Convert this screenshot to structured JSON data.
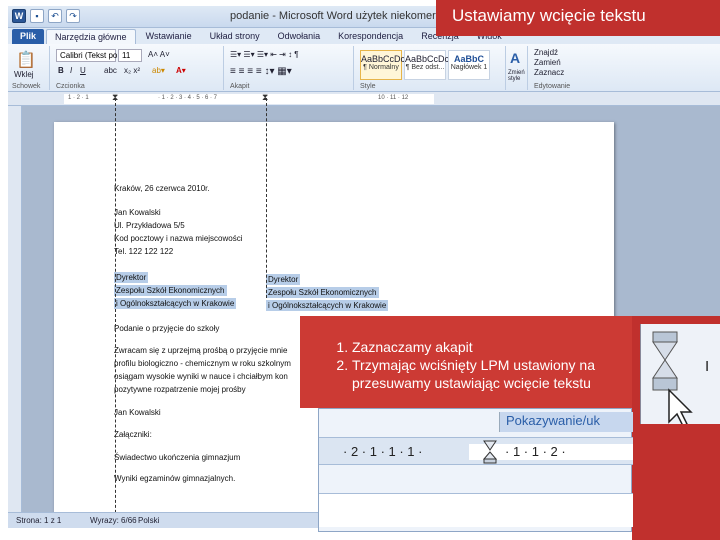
{
  "window": {
    "title": "podanie - Microsoft Word użytek niekomercyjny"
  },
  "tabs": [
    "Plik",
    "Narzędzia główne",
    "Wstawianie",
    "Układ strony",
    "Odwołania",
    "Korespondencja",
    "Recenzja",
    "Widok"
  ],
  "ribbon": {
    "font_name": "Calibri (Tekst po",
    "font_size": "11",
    "paste_label": "Wklej",
    "styles": [
      {
        "sample": "AaBbCcDc",
        "name": "¶ Normalny"
      },
      {
        "sample": "AaBbCcDc",
        "name": "¶ Bez odst..."
      },
      {
        "sample": "AaBbC",
        "name": "Nagłówek 1"
      }
    ],
    "change_styles": "Zmień style",
    "find": "Znajdź",
    "replace": "Zamień",
    "select": "Zaznacz",
    "group_labels": [
      "Schowek",
      "Czcionka",
      "Akapit",
      "Style",
      "Edytowanie"
    ]
  },
  "ruler": {
    "ticks": [
      "1 · 2 · 1",
      "· 1 · 2 · 3 · 4 · 5 · 6 · 7",
      "10 · 11 · 12"
    ]
  },
  "document": {
    "lines": [
      "Kraków, 26 czerwca 2010r.",
      "Jan Kowalski",
      "Ul. Przykładowa 5/5",
      "Kod pocztowy i nazwa miejscowości",
      "Tel. 122 122 122",
      "Dyrektor",
      "Zespołu Szkół Ekonomicznych",
      "i Ogólnokształcących w Krakowie",
      "Podanie o przyjęcie do szkoły",
      "Zwracam się z uprzejmą prośbą o przyjęcie mnie",
      "profilu biologiczno - chemicznym w roku szkolnym",
      "osiągam wysokie wyniki w nauce i chciałbym kon",
      "pozytywne rozpatrzenie mojej prośby",
      "Jan Kowalski",
      "Załączniki:",
      "Świadectwo ukończenia gimnazjum",
      "Wyniki egzaminów gimnazjalnych."
    ],
    "indented_copy": [
      "Dyrektor",
      "Zespołu Szkół Ekonomicznych",
      "i Ogólnokształcących w Krakowie"
    ]
  },
  "statusbar": {
    "page": "Strona: 1 z 1",
    "words": "Wyrazy: 6/66",
    "language": "Polski"
  },
  "overlay": {
    "title": "Ustawiamy wcięcie tekstu",
    "steps": [
      "Zaznaczamy akapit",
      "Trzymając wciśnięty LPM ustawiony na",
      "przesuwamy ustawiając wcięcie tekstu"
    ],
    "zoom_banner": "Pokazywanie/uk",
    "zoom_ticks": [
      "· 2 · 1 · 1 · 1 ·",
      "· 1 · 1 · 2 ·"
    ]
  },
  "colors": {
    "accent_red": "#c0302d",
    "ribbon_blue": "#dfe9f5",
    "file_tab": "#2a5ea8",
    "selection": "#b7cde8"
  }
}
